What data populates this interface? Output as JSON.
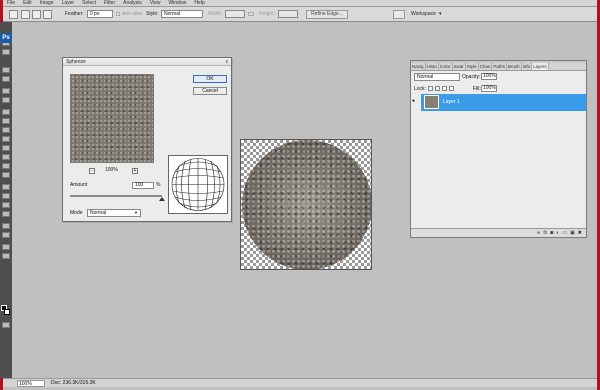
{
  "menubar": {
    "items": [
      "File",
      "Edit",
      "Image",
      "Layer",
      "Select",
      "Filter",
      "Analysis",
      "View",
      "Window",
      "Help"
    ]
  },
  "options_bar": {
    "feather_label": "Feather:",
    "feather_value": "0 px",
    "antialias_label": "Anti-alias",
    "style_label": "Style:",
    "style_value": "Normal",
    "width_label": "Width:",
    "height_label": "Height:",
    "refine_edge_label": "Refine Edge...",
    "workspace_label": "Workspace"
  },
  "tools": {
    "logo": "Ps",
    "foreground_color": "#000000",
    "background_color": "#ffffff"
  },
  "status": {
    "zoom": "100%",
    "doc": "Doc: 236.3K/315.3K"
  },
  "dialog": {
    "title": "Spherize",
    "close": "x",
    "ok_label": "OK",
    "cancel_label": "Cancel",
    "zoom_out": "-",
    "zoom_in": "+",
    "zoom_percent": "100%",
    "amount_label": "Amount",
    "amount_value": "100",
    "amount_unit": "%",
    "mode_label": "Mode",
    "mode_value": "Normal"
  },
  "layers_panel": {
    "tabs": [
      "Navig",
      "Histo",
      "Color",
      "Swat",
      "Style",
      "Chan",
      "Paths",
      "Brush",
      "Info",
      "Layers"
    ],
    "blend_mode": "Normal",
    "opacity_label": "Opacity:",
    "opacity_value": "100%",
    "lock_label": "Lock:",
    "fill_label": "Fill:",
    "fill_value": "100%",
    "layer_name": "Layer 1",
    "footer_icons": [
      "link-icon",
      "fx-icon",
      "mask-icon",
      "adjustment-icon",
      "group-icon",
      "new-layer-icon",
      "trash-icon"
    ],
    "accent_color": "#3a9ce8"
  }
}
